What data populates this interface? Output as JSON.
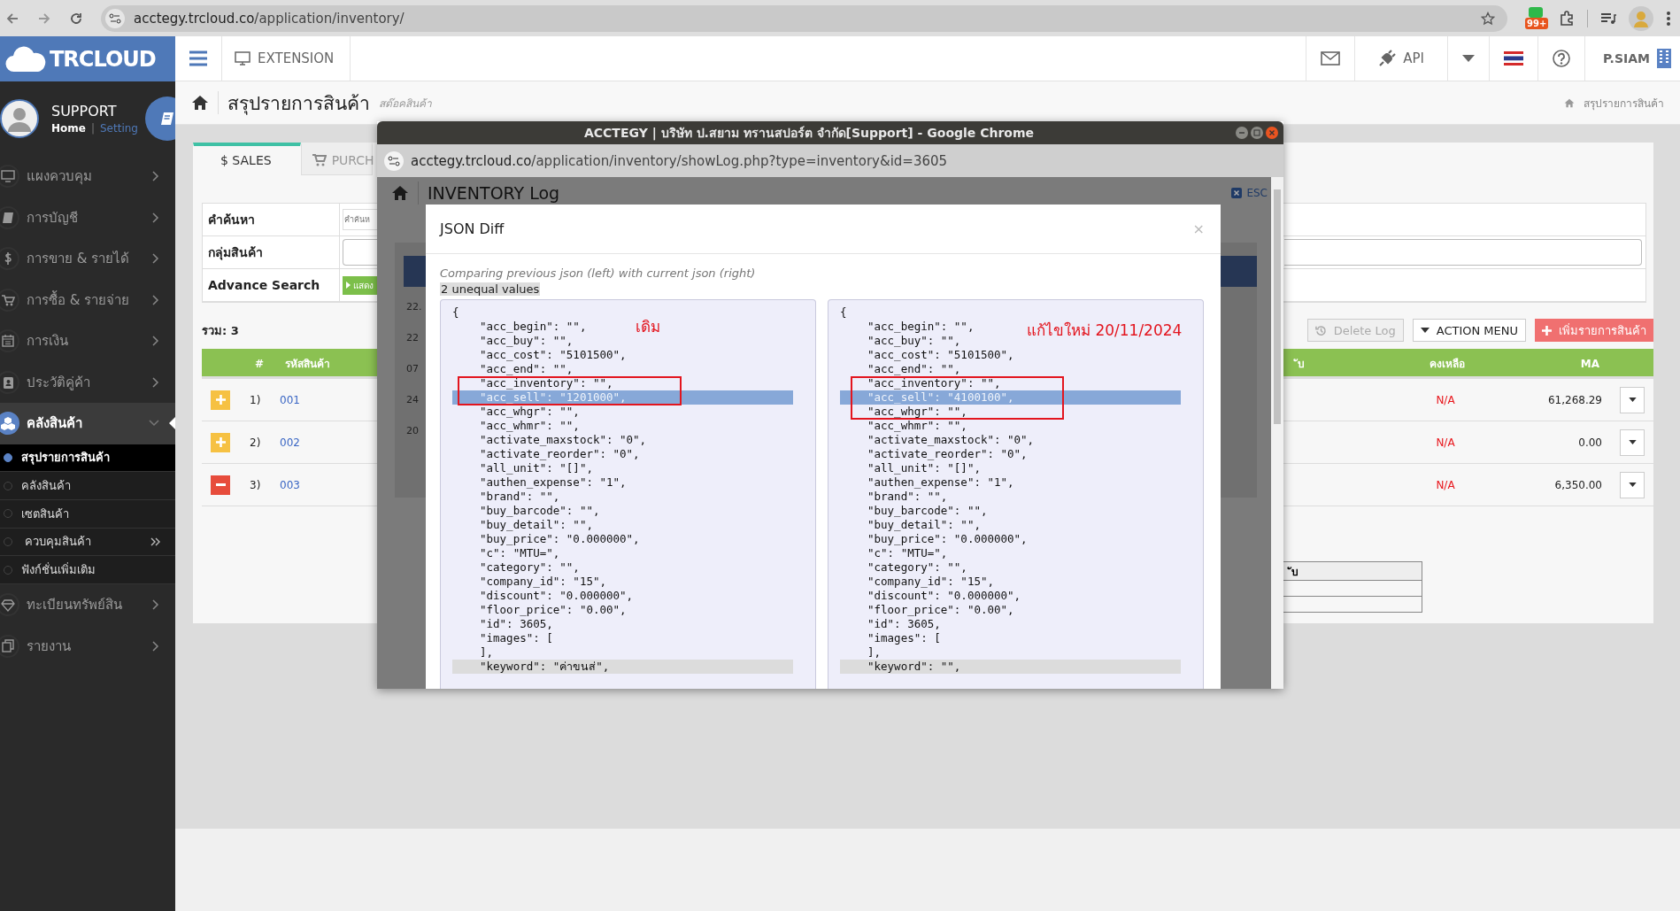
{
  "browser": {
    "url_host": "acctegy.trcloud.co",
    "url_path": "/application/inventory/",
    "badge": "99+"
  },
  "header": {
    "logo": "TRCLOUD",
    "extension": "EXTENSION",
    "api": "API",
    "user": "P.SIAM"
  },
  "sidebar": {
    "user": {
      "name": "SUPPORT",
      "home": "Home",
      "separator": "|",
      "setting": "Setting"
    },
    "items": [
      {
        "label": "แผงควบคุม",
        "expanded": false
      },
      {
        "label": "การบัญชี",
        "expanded": false
      },
      {
        "label": "การขาย & รายได้",
        "expanded": false
      },
      {
        "label": "การซื้อ & รายจ่าย",
        "expanded": false
      },
      {
        "label": "การเงิน",
        "expanded": false
      },
      {
        "label": "ประวัติคู่ค้า",
        "expanded": false
      },
      {
        "label": "คลังสินค้า",
        "expanded": true,
        "children": [
          {
            "label": "สรุปรายการสินค้า",
            "selected": true,
            "has_submenu": false
          },
          {
            "label": "คลังสินค้า",
            "selected": false,
            "has_submenu": false
          },
          {
            "label": "เซตสินค้า",
            "selected": false,
            "has_submenu": false
          },
          {
            "label": "ควบคุมสินค้า",
            "selected": false,
            "has_submenu": true
          },
          {
            "label": "ฟังก์ชั่นเพิ่มเติม",
            "selected": false,
            "has_submenu": false
          }
        ]
      },
      {
        "label": "ทะเบียนทรัพย์สิน",
        "expanded": false
      },
      {
        "label": "รายงาน",
        "expanded": false
      }
    ]
  },
  "page": {
    "title": "สรุปรายการสินค้า",
    "subtitle": "สต๊อคสินค้า",
    "breadcrumb": "สรุปรายการสินค้า"
  },
  "tabs": [
    {
      "label": "$ SALES",
      "selected": true
    },
    {
      "label": "PURCH",
      "selected": false
    }
  ],
  "search": [
    {
      "label": "คำค้นหา",
      "kind": "text",
      "placeholder": "คำค้นห"
    },
    {
      "label": "กลุ่มสินค้า",
      "kind": "select"
    },
    {
      "label": "Advance Search",
      "kind": "button",
      "button": "แสดง"
    }
  ],
  "total": "รวม: 3",
  "actions": [
    {
      "label": "Delete Log",
      "kind": "history"
    },
    {
      "label": "ACTION MENU",
      "kind": "menu"
    },
    {
      "label": "เพิ่มรายการสินค้า",
      "kind": "add"
    }
  ],
  "table": {
    "columns": [
      "#",
      "รหัสสินค้า",
      "ับ",
      "คงเหลือ",
      "MA"
    ],
    "rows": [
      {
        "kind": "expand",
        "number": "1)",
        "code": "001",
        "balance": "N/A",
        "ma": "61,268.29"
      },
      {
        "kind": "expand",
        "number": "2)",
        "code": "002",
        "balance": "N/A",
        "ma": "0.00"
      },
      {
        "kind": "collapse",
        "number": "3)",
        "code": "003",
        "balance": "N/A",
        "ma": "6,350.00"
      }
    ]
  },
  "mini_table": {
    "header": "ับ"
  },
  "popup": {
    "title": "ACCTEGY | บริษัท ป.สยาม ทรานสปอร์ต จำกัด[Support] - Google Chrome",
    "url_host": "acctegy.trcloud.co",
    "url_path": "/application/inventory/showLog.php?type=inventory&id=3605",
    "page_title": "INVENTORY Log",
    "esc": "ESC",
    "log_rows": [
      "22.",
      "22",
      "07",
      "24",
      "20"
    ],
    "dialog": {
      "title": "JSON Diff",
      "close": "×",
      "note": "Comparing previous json (left) with current json (right)",
      "summary": "2 unequal values",
      "panels": [
        {
          "annotation": "เดิม",
          "open": "{",
          "entries": [
            {
              "text": "\"acc_begin\": \"\",",
              "changed": false,
              "shaded": false
            },
            {
              "text": "\"acc_buy\": \"\",",
              "changed": false,
              "shaded": false
            },
            {
              "text": "\"acc_cost\": \"5101500\",",
              "changed": false,
              "shaded": false
            },
            {
              "text": "\"acc_end\": \"\",",
              "changed": false,
              "shaded": false
            },
            {
              "text": "\"acc_inventory\": \"\",",
              "changed": false,
              "shaded": false
            },
            {
              "text": "\"acc_sell\": \"1201000\",",
              "changed": true,
              "shaded": false
            },
            {
              "text": "\"acc_whgr\": \"\",",
              "changed": false,
              "shaded": false
            },
            {
              "text": "\"acc_whmr\": \"\",",
              "changed": false,
              "shaded": false
            },
            {
              "text": "\"activate_maxstock\": \"0\",",
              "changed": false,
              "shaded": false
            },
            {
              "text": "\"activate_reorder\": \"0\",",
              "changed": false,
              "shaded": false
            },
            {
              "text": "\"all_unit\": \"[]\",",
              "changed": false,
              "shaded": false
            },
            {
              "text": "\"authen_expense\": \"1\",",
              "changed": false,
              "shaded": false
            },
            {
              "text": "\"brand\": \"\",",
              "changed": false,
              "shaded": false
            },
            {
              "text": "\"buy_barcode\": \"\",",
              "changed": false,
              "shaded": false
            },
            {
              "text": "\"buy_detail\": \"\",",
              "changed": false,
              "shaded": false
            },
            {
              "text": "\"buy_price\": \"0.000000\",",
              "changed": false,
              "shaded": false
            },
            {
              "text": "\"c\": \"MTU=\",",
              "changed": false,
              "shaded": false
            },
            {
              "text": "\"category\": \"\",",
              "changed": false,
              "shaded": false
            },
            {
              "text": "\"company_id\": \"15\",",
              "changed": false,
              "shaded": false
            },
            {
              "text": "\"discount\": \"0.000000\",",
              "changed": false,
              "shaded": false
            },
            {
              "text": "\"floor_price\": \"0.00\",",
              "changed": false,
              "shaded": false
            },
            {
              "text": "\"id\": 3605,",
              "changed": false,
              "shaded": false
            },
            {
              "text": "\"images\": [",
              "changed": false,
              "shaded": false
            },
            {
              "text": "],",
              "changed": false,
              "shaded": false
            },
            {
              "text": "\"keyword\": \"ค่าขนส่\",",
              "changed": false,
              "shaded": true
            }
          ]
        },
        {
          "annotation": "แก้ไขใหม่ 20/11/2024",
          "open": "{",
          "entries": [
            {
              "text": "\"acc_begin\": \"\",",
              "changed": false,
              "shaded": false
            },
            {
              "text": "\"acc_buy\": \"\",",
              "changed": false,
              "shaded": false
            },
            {
              "text": "\"acc_cost\": \"5101500\",",
              "changed": false,
              "shaded": false
            },
            {
              "text": "\"acc_end\": \"\",",
              "changed": false,
              "shaded": false
            },
            {
              "text": "\"acc_inventory\": \"\",",
              "changed": false,
              "shaded": false
            },
            {
              "text": "\"acc_sell\": \"4100100\",",
              "changed": true,
              "shaded": false
            },
            {
              "text": "\"acc_whgr\": \"\",",
              "changed": false,
              "shaded": false
            },
            {
              "text": "\"acc_whmr\": \"\",",
              "changed": false,
              "shaded": false
            },
            {
              "text": "\"activate_maxstock\": \"0\",",
              "changed": false,
              "shaded": false
            },
            {
              "text": "\"activate_reorder\": \"0\",",
              "changed": false,
              "shaded": false
            },
            {
              "text": "\"all_unit\": \"[]\",",
              "changed": false,
              "shaded": false
            },
            {
              "text": "\"authen_expense\": \"1\",",
              "changed": false,
              "shaded": false
            },
            {
              "text": "\"brand\": \"\",",
              "changed": false,
              "shaded": false
            },
            {
              "text": "\"buy_barcode\": \"\",",
              "changed": false,
              "shaded": false
            },
            {
              "text": "\"buy_detail\": \"\",",
              "changed": false,
              "shaded": false
            },
            {
              "text": "\"buy_price\": \"0.000000\",",
              "changed": false,
              "shaded": false
            },
            {
              "text": "\"c\": \"MTU=\",",
              "changed": false,
              "shaded": false
            },
            {
              "text": "\"category\": \"\",",
              "changed": false,
              "shaded": false
            },
            {
              "text": "\"company_id\": \"15\",",
              "changed": false,
              "shaded": false
            },
            {
              "text": "\"discount\": \"0.000000\",",
              "changed": false,
              "shaded": false
            },
            {
              "text": "\"floor_price\": \"0.00\",",
              "changed": false,
              "shaded": false
            },
            {
              "text": "\"id\": 3605,",
              "changed": false,
              "shaded": false
            },
            {
              "text": "\"images\": [",
              "changed": false,
              "shaded": false
            },
            {
              "text": "],",
              "changed": false,
              "shaded": false
            },
            {
              "text": "\"keyword\": \"\",",
              "changed": false,
              "shaded": true
            }
          ]
        }
      ]
    }
  }
}
